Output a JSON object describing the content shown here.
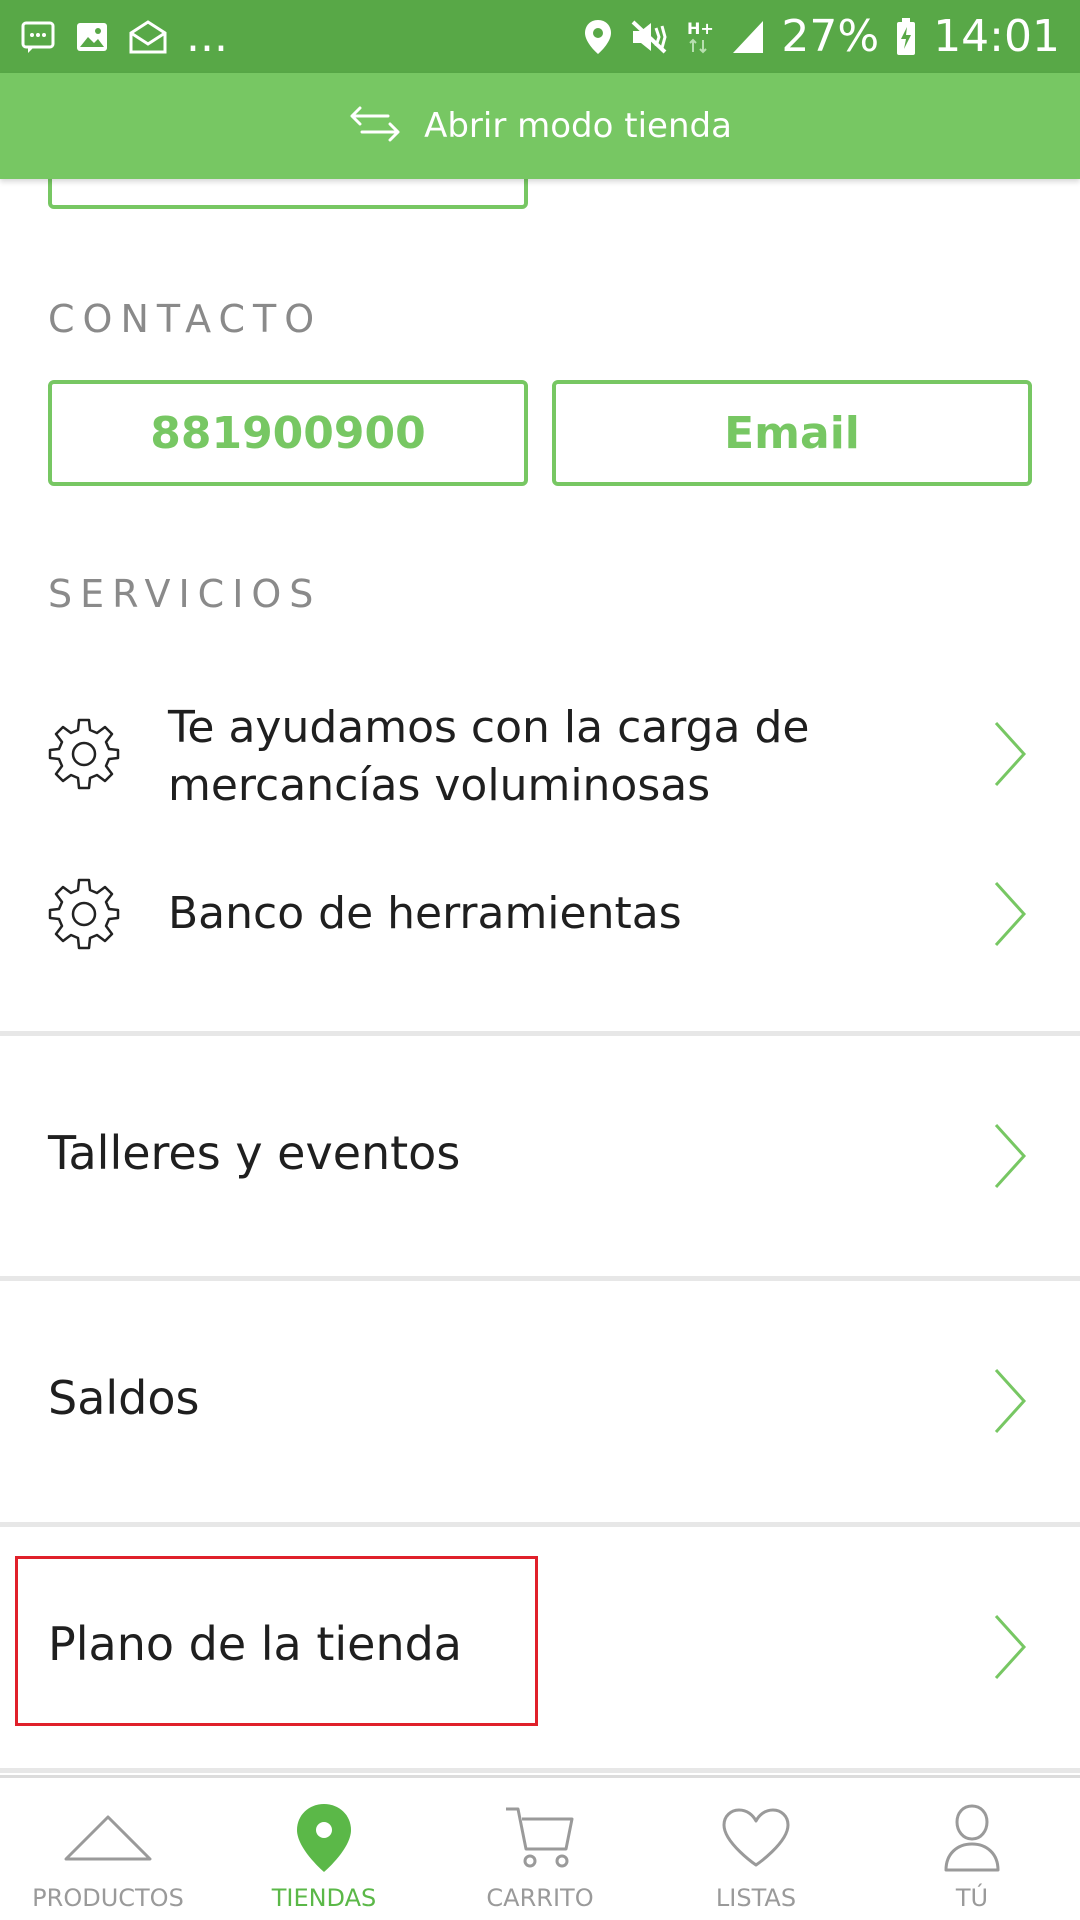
{
  "status_bar": {
    "dots": "...",
    "network": "H+",
    "battery": "27%",
    "time": "14:01"
  },
  "action_bar": {
    "label": "Abrir modo tienda",
    "icon": "swap-arrows-icon"
  },
  "contact": {
    "title": "CONTACTO",
    "phone_label": "881900900",
    "email_label": "Email"
  },
  "services": {
    "title": "SERVICIOS",
    "items": [
      {
        "label": "Te ayudamos con la carga de mercancías voluminosas",
        "icon": "gear-icon"
      },
      {
        "label": "Banco de herramientas",
        "icon": "gear-icon"
      }
    ]
  },
  "links": [
    {
      "label": "Talleres y eventos"
    },
    {
      "label": "Saldos"
    },
    {
      "label": "Plano de la tienda"
    }
  ],
  "bottom_nav": [
    {
      "label": "PRODUCTOS",
      "icon": "triangle-icon",
      "active": false
    },
    {
      "label": "TIENDAS",
      "icon": "location-pin-icon",
      "active": true
    },
    {
      "label": "CARRITO",
      "icon": "cart-icon",
      "active": false
    },
    {
      "label": "LISTAS",
      "icon": "heart-icon",
      "active": false
    },
    {
      "label": "TÚ",
      "icon": "user-icon",
      "active": false
    }
  ],
  "colors": {
    "status_bar": "#58a847",
    "primary": "#77c763",
    "active_nav": "#5bb848",
    "highlight": "#e0202a"
  }
}
